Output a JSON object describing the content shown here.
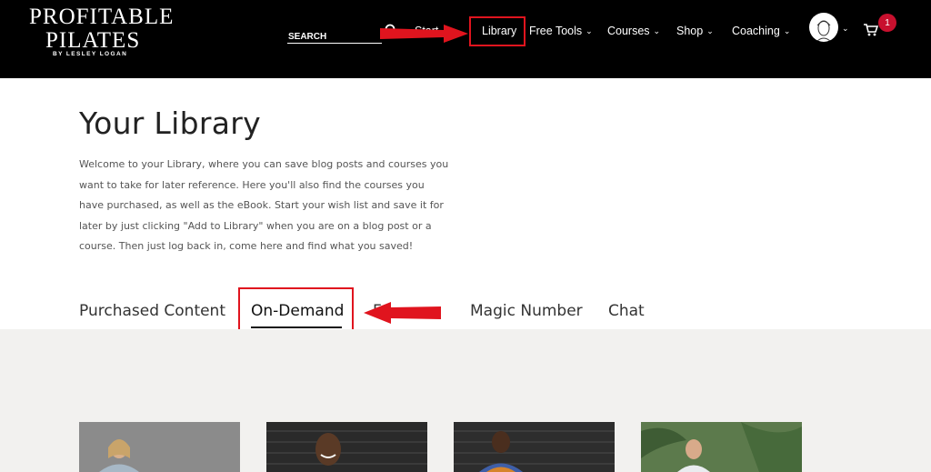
{
  "logo": {
    "line1": "PROFITABLE",
    "line2": "PILATES",
    "line3": "BY LESLEY LOGAN"
  },
  "search": {
    "placeholder": "SEARCH"
  },
  "nav": {
    "hidden_label": "Start",
    "library": "Library",
    "free_tools": "Free Tools",
    "courses": "Courses",
    "shop": "Shop",
    "coaching": "Coaching"
  },
  "cart": {
    "count": "1"
  },
  "main": {
    "title": "Your Library",
    "intro": "Welcome to your Library, where you can save blog posts and courses you want to take for later reference. Here you'll also find the courses you have purchased, as well as the eBook. Start your wish list and save it for later by just clicking \"Add to Library\" when you are on a blog post or a course. Then just log back in, come here and find what you saved!"
  },
  "tabs": [
    {
      "label": "Purchased Content"
    },
    {
      "label": "On-Demand"
    },
    {
      "label": "Favorites"
    },
    {
      "label": "Magic Number"
    },
    {
      "label": "Chat"
    }
  ],
  "colors": {
    "header_bg": "#000000",
    "annotation_red": "#e0141e",
    "badge_red": "#c8102e",
    "content_gray": "#f2f1ef"
  },
  "icons": [
    "search-icon",
    "chevron-down-icon",
    "avatar",
    "cart-icon"
  ]
}
